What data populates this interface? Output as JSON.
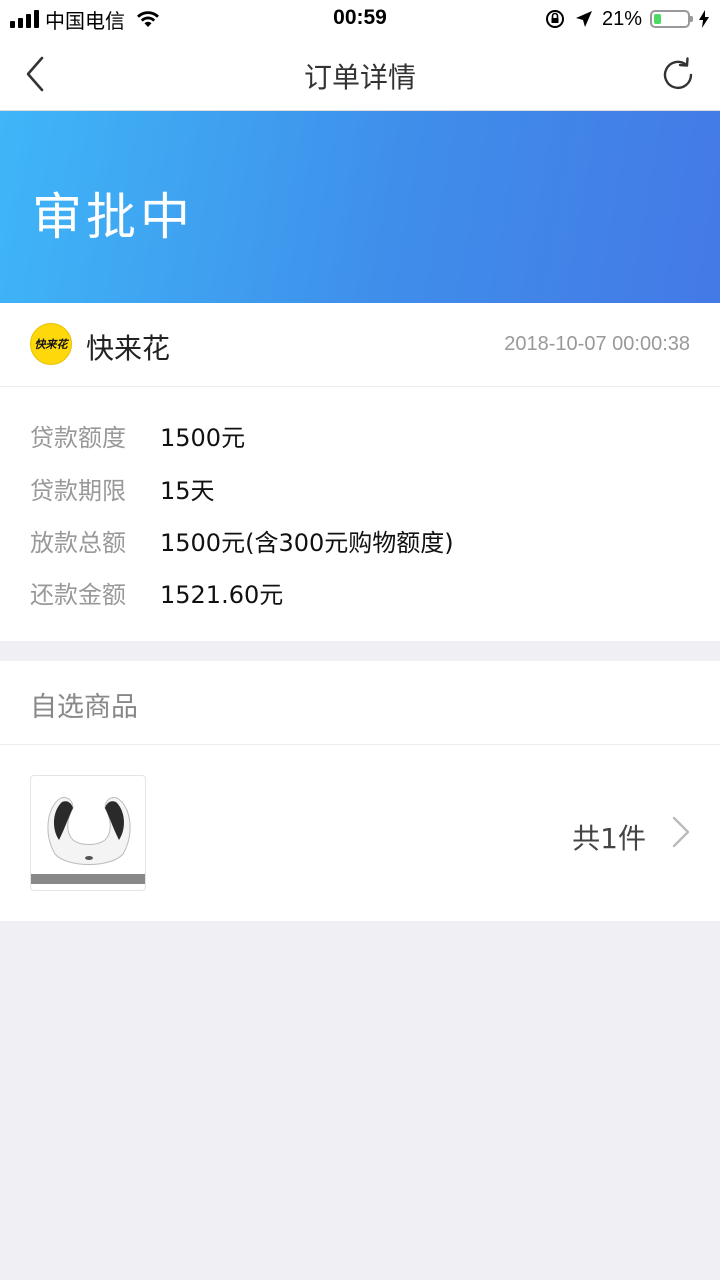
{
  "status_bar": {
    "carrier": "中国电信",
    "time": "00:59",
    "battery_percent": "21%",
    "battery_level": 0.21
  },
  "nav": {
    "title": "订单详情",
    "back_icon": "chevron-left-icon",
    "refresh_icon": "refresh-icon"
  },
  "banner": {
    "status": "审批中",
    "gradient_start": "#3fb6f8",
    "gradient_end": "#4479e6"
  },
  "merchant": {
    "name": "快来花",
    "logo_text": "快来花",
    "datetime": "2018-10-07 00:00:38",
    "logo_color": "#fed80a"
  },
  "details": [
    {
      "label": "贷款额度",
      "value": "1500元"
    },
    {
      "label": "贷款期限",
      "value": "15天"
    },
    {
      "label": "放款总额",
      "value": "1500元(含300元购物额度)"
    },
    {
      "label": "还款金额",
      "value": "1521.60元"
    }
  ],
  "goods": {
    "title": "自选商品",
    "count": "共1件",
    "thumbnail_icon": "neck-massager-image"
  }
}
